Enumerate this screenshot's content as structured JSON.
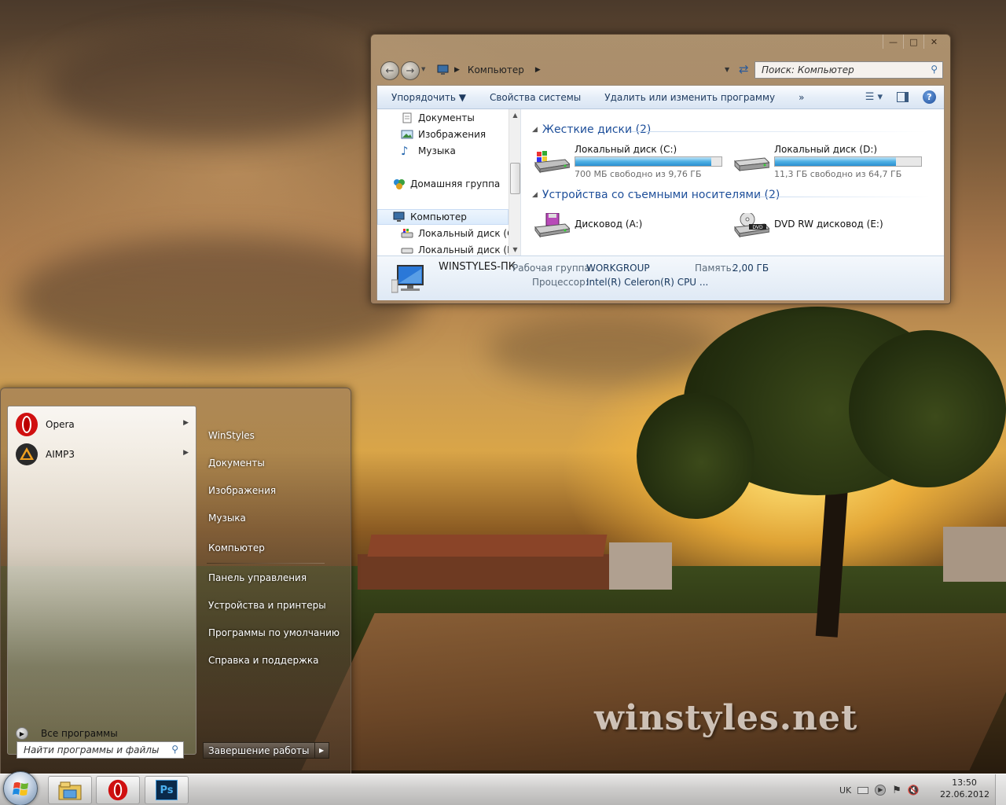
{
  "explorer": {
    "address_path": "Компьютер",
    "search_placeholder": "Поиск: Компьютер",
    "commands": [
      "Упорядочить ▼",
      "Свойства системы",
      "Удалить или изменить программу",
      "»"
    ],
    "nav_items": [
      {
        "label": "Документы",
        "icon": "documents-icon"
      },
      {
        "label": "Изображения",
        "icon": "pictures-icon"
      },
      {
        "label": "Музыка",
        "icon": "music-icon"
      },
      {
        "label": "Домашняя группа",
        "icon": "homegroup-icon"
      },
      {
        "label": "Компьютер",
        "icon": "computer-icon",
        "selected": true
      },
      {
        "label": "Локальный диск (C:)",
        "icon": "drive-c-icon"
      },
      {
        "label": "Локальный диск  (D:)",
        "icon": "drive-d-icon"
      }
    ],
    "groups": {
      "hard_disks": {
        "title": "Жесткие диски (2)",
        "drives": [
          {
            "name": "Локальный диск (C:)",
            "free": "700 МБ свободно из 9,76 ГБ",
            "used_fraction": 0.93
          },
          {
            "name": "Локальный диск  (D:)",
            "free": "11,3 ГБ свободно из 64,7 ГБ",
            "used_fraction": 0.83
          }
        ]
      },
      "removable": {
        "title": "Устройства со съемными носителями (2)",
        "devices": [
          {
            "name": "Дисковод (A:)",
            "icon": "floppy-drive-icon"
          },
          {
            "name": "DVD RW дисковод (E:)",
            "icon": "dvd-drive-icon"
          }
        ]
      }
    },
    "details": {
      "pc_name": "WINSTYLES-ПК",
      "workgroup_label": "Рабочая группа:",
      "workgroup_value": "WORKGROUP",
      "memory_label": "Память:",
      "memory_value": "2,00 ГБ",
      "cpu_label": "Процессор:",
      "cpu_value": "Intel(R) Celeron(R) CPU ..."
    }
  },
  "start_menu": {
    "pinned": [
      {
        "label": "Opera",
        "icon": "opera-icon"
      },
      {
        "label": "AIMP3",
        "icon": "aimp-icon"
      }
    ],
    "all_programs": "Все программы",
    "search_placeholder": "Найти программы и файлы",
    "right_items": [
      "WinStyles",
      "Документы",
      "Изображения",
      "Музыка",
      "Компьютер",
      "Панель управления",
      "Устройства и принтеры",
      "Программы по умолчанию",
      "Справка и поддержка"
    ],
    "shutdown_label": "Завершение работы"
  },
  "taskbar": {
    "apps": [
      "explorer-icon",
      "opera-icon",
      "photoshop-icon"
    ],
    "photoshop_label": "Ps",
    "language": "UK",
    "time": "13:50",
    "date": "22.06.2012"
  },
  "desktop": {
    "watermark": "winstyles.net"
  },
  "colors": {
    "link_blue": "#1e4f9a",
    "drive_bar": "#2a8fd0",
    "opera_red": "#cc1010"
  }
}
